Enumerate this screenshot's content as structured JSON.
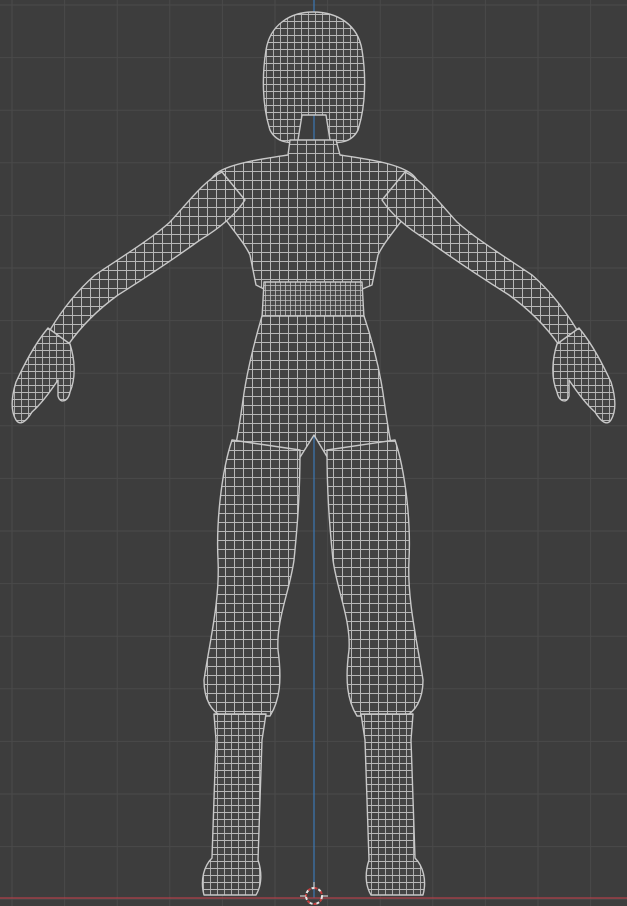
{
  "viewport": {
    "background_color": "#3d3d3d",
    "grid_color": "#4a4a4a",
    "z_axis_color": "#3b78b5",
    "x_axis_color": "#b0404a",
    "wire_color": "#b9b9b9",
    "wire_shadow_color": "#2c2c2c",
    "cursor_colors": [
      "#e6e6e6",
      "#c23b3b"
    ]
  },
  "model": {
    "icon": "wireframe-female-character-mesh",
    "pose": "A-pose",
    "shading": "wireframe"
  },
  "gizmos": {
    "origin_cursor_icon": "3d-cursor-icon"
  }
}
